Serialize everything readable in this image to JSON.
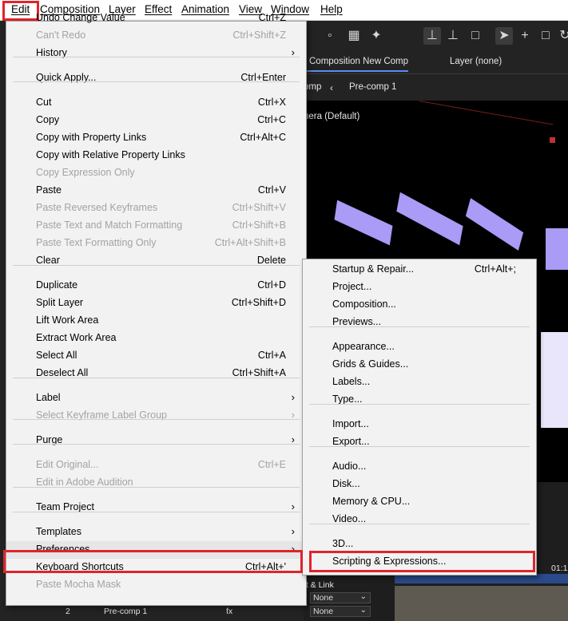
{
  "menubar": {
    "items": [
      "Edit",
      "Composition",
      "Layer",
      "Effect",
      "Animation",
      "View",
      "Window",
      "Help"
    ]
  },
  "toolbar": {
    "icons": [
      "eraser-icon",
      "puppet-icon",
      "pin-icon",
      "axis-local-icon",
      "axis-world-icon",
      "axis-view-icon",
      "selection-arrow-icon",
      "hand-plus-icon",
      "square-icon",
      "rotate-icon"
    ]
  },
  "viewer_panel": {
    "tab_composition": "Composition New Comp",
    "tab_layer": "Layer (none)",
    "breadcrumb_partial": "omp",
    "breadcrumb_precomp": "Pre-comp 1",
    "camera_label": "nera (Default)"
  },
  "timeline": {
    "link_label": "nt & Link",
    "time_label": "01:1",
    "none_1": "None",
    "none_2": "None",
    "layer_number": "2",
    "layer_name": "Pre-comp 1",
    "parent_label": "fx"
  },
  "edit_menu": {
    "items": [
      {
        "label": "Undo Change Value",
        "shortcut": "Ctrl+Z",
        "disabled": false
      },
      {
        "label": "Can't Redo",
        "shortcut": "Ctrl+Shift+Z",
        "disabled": true
      },
      {
        "label": "History",
        "shortcut": "",
        "disabled": false,
        "submenu": true
      },
      {
        "label": "Quick Apply...",
        "shortcut": "Ctrl+Enter",
        "disabled": false
      },
      {
        "label": "Cut",
        "shortcut": "Ctrl+X",
        "disabled": false
      },
      {
        "label": "Copy",
        "shortcut": "Ctrl+C",
        "disabled": false
      },
      {
        "label": "Copy with Property Links",
        "shortcut": "Ctrl+Alt+C",
        "disabled": false
      },
      {
        "label": "Copy with Relative Property Links",
        "shortcut": "",
        "disabled": false
      },
      {
        "label": "Copy Expression Only",
        "shortcut": "",
        "disabled": true
      },
      {
        "label": "Paste",
        "shortcut": "Ctrl+V",
        "disabled": false
      },
      {
        "label": "Paste Reversed Keyframes",
        "shortcut": "Ctrl+Shift+V",
        "disabled": true
      },
      {
        "label": "Paste Text and Match Formatting",
        "shortcut": "Ctrl+Shift+B",
        "disabled": true
      },
      {
        "label": "Paste Text Formatting Only",
        "shortcut": "Ctrl+Alt+Shift+B",
        "disabled": true
      },
      {
        "label": "Clear",
        "shortcut": "Delete",
        "disabled": false
      },
      {
        "label": "Duplicate",
        "shortcut": "Ctrl+D",
        "disabled": false
      },
      {
        "label": "Split Layer",
        "shortcut": "Ctrl+Shift+D",
        "disabled": false
      },
      {
        "label": "Lift Work Area",
        "shortcut": "",
        "disabled": false
      },
      {
        "label": "Extract Work Area",
        "shortcut": "",
        "disabled": false
      },
      {
        "label": "Select All",
        "shortcut": "Ctrl+A",
        "disabled": false
      },
      {
        "label": "Deselect All",
        "shortcut": "Ctrl+Shift+A",
        "disabled": false
      },
      {
        "label": "Label",
        "shortcut": "",
        "disabled": false,
        "submenu": true
      },
      {
        "label": "Select Keyframe Label Group",
        "shortcut": "",
        "disabled": true,
        "submenu": true
      },
      {
        "label": "Purge",
        "shortcut": "",
        "disabled": false,
        "submenu": true
      },
      {
        "label": "Edit Original...",
        "shortcut": "Ctrl+E",
        "disabled": true
      },
      {
        "label": "Edit in Adobe Audition",
        "shortcut": "",
        "disabled": true
      },
      {
        "label": "Team Project",
        "shortcut": "",
        "disabled": false,
        "submenu": true
      },
      {
        "label": "Templates",
        "shortcut": "",
        "disabled": false,
        "submenu": true
      },
      {
        "label": "Preferences",
        "shortcut": "",
        "disabled": false,
        "submenu": true,
        "selected": true
      },
      {
        "label": "Keyboard Shortcuts",
        "shortcut": "Ctrl+Alt+'",
        "disabled": false
      },
      {
        "label": "Paste Mocha Mask",
        "shortcut": "",
        "disabled": true
      }
    ]
  },
  "preferences_menu": {
    "items": [
      {
        "label": "Startup & Repair...",
        "shortcut": "Ctrl+Alt+;"
      },
      {
        "label": "Project...",
        "shortcut": ""
      },
      {
        "label": "Composition...",
        "shortcut": ""
      },
      {
        "label": "Previews...",
        "shortcut": ""
      },
      {
        "label": "Appearance...",
        "shortcut": ""
      },
      {
        "label": "Grids & Guides...",
        "shortcut": ""
      },
      {
        "label": "Labels...",
        "shortcut": ""
      },
      {
        "label": "Type...",
        "shortcut": ""
      },
      {
        "label": "Import...",
        "shortcut": ""
      },
      {
        "label": "Export...",
        "shortcut": ""
      },
      {
        "label": "Audio...",
        "shortcut": ""
      },
      {
        "label": "Disk...",
        "shortcut": ""
      },
      {
        "label": "Memory & CPU...",
        "shortcut": ""
      },
      {
        "label": "Video...",
        "shortcut": ""
      },
      {
        "label": "3D...",
        "shortcut": ""
      },
      {
        "label": "Scripting & Expressions...",
        "shortcut": ""
      }
    ]
  },
  "colors": {
    "highlight_border": "#e0242b",
    "shape_fill": "#a99bf6",
    "accent_blue": "#5a8dee"
  }
}
